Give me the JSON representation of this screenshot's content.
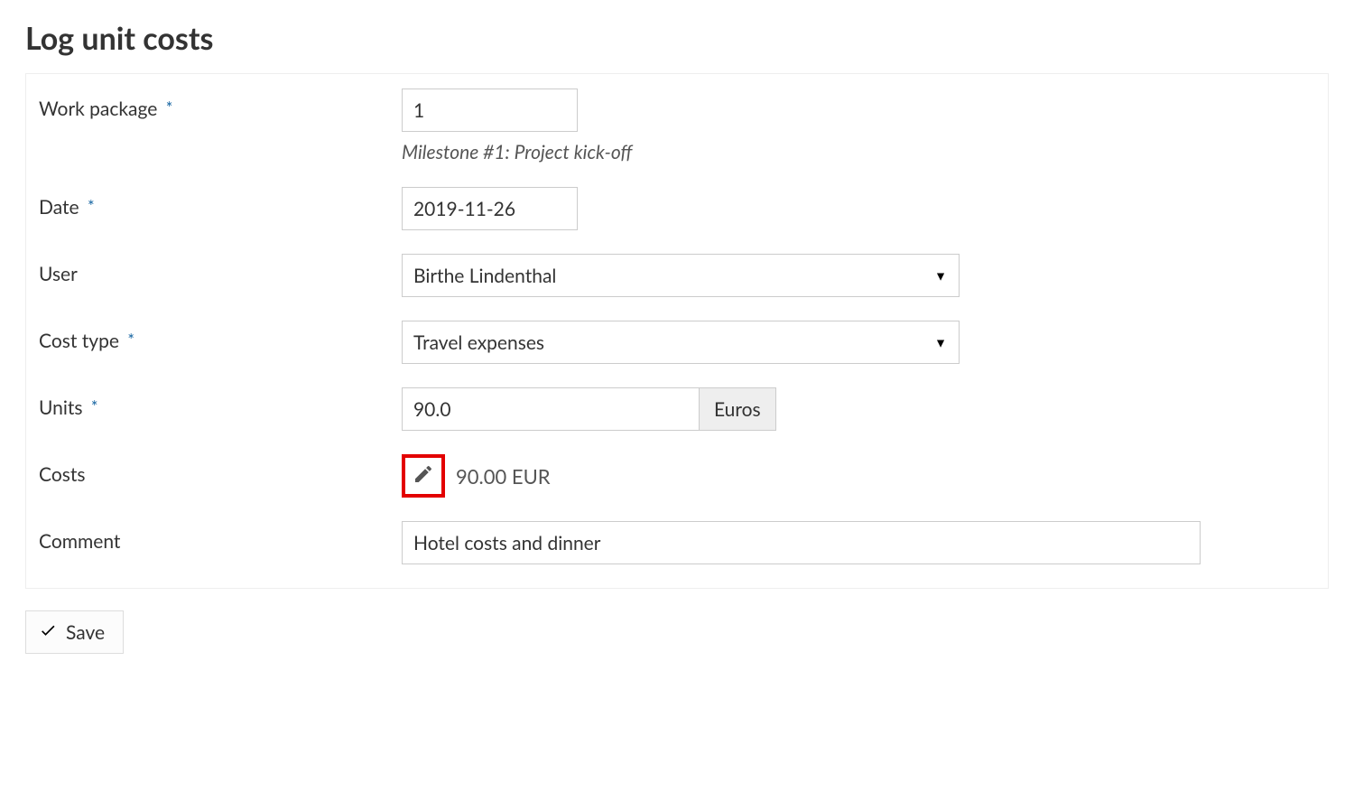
{
  "page": {
    "title": "Log unit costs"
  },
  "form": {
    "work_package": {
      "label": "Work package",
      "required": true,
      "value": "1",
      "helper": "Milestone #1: Project kick-off"
    },
    "date": {
      "label": "Date",
      "required": true,
      "value": "2019-11-26"
    },
    "user": {
      "label": "User",
      "value": "Birthe Lindenthal"
    },
    "cost_type": {
      "label": "Cost type",
      "required": true,
      "value": "Travel expenses"
    },
    "units": {
      "label": "Units",
      "required": true,
      "value": "90.0",
      "suffix": "Euros"
    },
    "costs": {
      "label": "Costs",
      "value": "90.00 EUR"
    },
    "comment": {
      "label": "Comment",
      "value": "Hotel costs and dinner"
    }
  },
  "buttons": {
    "save": "Save"
  },
  "marks": {
    "required": "*"
  }
}
